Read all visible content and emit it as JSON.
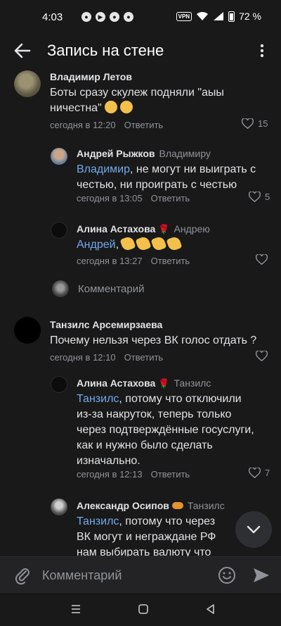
{
  "status": {
    "time": "4:03",
    "vpn": "VPN",
    "battery": "72 %"
  },
  "header": {
    "title": "Запись на стене"
  },
  "comments": [
    {
      "author": "Владимир Летов",
      "reply_to": "",
      "text": "Боты сразу скулеж подняли \"аыы ничестна\"",
      "time": "сегодня в 12:20",
      "reply_label": "Ответить",
      "likes": "15"
    },
    {
      "author": "Андрей Рыжков",
      "reply_to": "Владимиру",
      "mention": "Владимир",
      "text": ", не могут ни выиграть с честью, ни проиграть с честью",
      "time": "сегодня в 13:05",
      "reply_label": "Ответить",
      "likes": "5"
    },
    {
      "author": "Алина Астахова",
      "reply_to": "Андрею",
      "mention": "Андрей",
      "text": ",",
      "time": "сегодня в 13:27",
      "reply_label": "Ответить",
      "likes": ""
    },
    {
      "author": "Танзилс Арсемирзаева",
      "reply_to": "",
      "text": "Почему нельзя через ВК голос отдать ?",
      "time": "сегодня в 12:10",
      "reply_label": "Ответить",
      "likes": ""
    },
    {
      "author": "Алина Астахова",
      "reply_to": "Танзилс",
      "mention": "Танзилс",
      "text": ", потому что отключили из-за накруток, теперь только через подтверждённые госуслуги, как и нужно было сделать изначально.",
      "time": "сегодня в 12:13",
      "reply_label": "Ответить",
      "likes": "7"
    },
    {
      "author": "Александр Осипов",
      "reply_to": "Танзилс",
      "mention": "Танзилс",
      "text": ", потому что через ВК могут и неграждане РФ нам выбирать валюту что",
      "time": "",
      "reply_label": "",
      "likes": ""
    }
  ],
  "thread_comment_placeholder": "Комментарий",
  "input": {
    "placeholder": "Комментарий"
  },
  "colors": {
    "background": "#191919",
    "link": "#71aaeb",
    "secondary": "#8f9399",
    "text": "#e1e3e6"
  },
  "icons": [
    "back-arrow-icon",
    "more-vertical-icon",
    "heart-icon",
    "chevron-down-icon",
    "paperclip-icon",
    "smile-icon",
    "send-icon"
  ]
}
